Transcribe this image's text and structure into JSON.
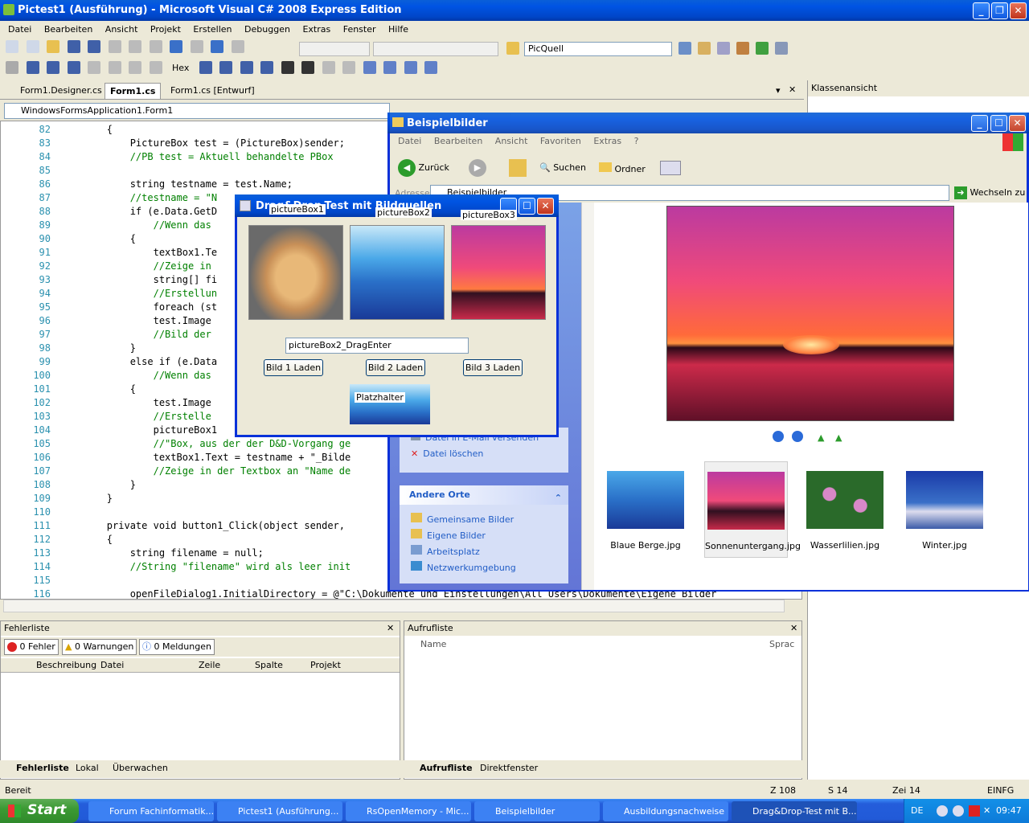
{
  "vs": {
    "title": "Pictest1 (Ausführung) - Microsoft Visual C# 2008 Express Edition",
    "menu": [
      "Datei",
      "Bearbeiten",
      "Ansicht",
      "Projekt",
      "Erstellen",
      "Debuggen",
      "Extras",
      "Fenster",
      "Hilfe"
    ],
    "toolbar_combo": "PicQuell",
    "hex_label": "Hex",
    "tabs": [
      "Form1.Designer.cs",
      "Form1.cs",
      "Form1.cs [Entwurf]"
    ],
    "class_combo": "WindowsFormsApplication1.Form1",
    "classview_title": "Klassenansicht",
    "status": {
      "ready": "Bereit",
      "line": "Z 108",
      "col": "S 14",
      "char": "Zei 14",
      "mode": "EINFG"
    }
  },
  "code": [
    {
      "n": "82",
      "t": "        {"
    },
    {
      "n": "83",
      "t": "            PictureBox test = (PictureBox)sender;"
    },
    {
      "n": "84",
      "t": "            //PB test = Aktuell behandelte PBox"
    },
    {
      "n": "85",
      "t": ""
    },
    {
      "n": "86",
      "t": "            string testname = test.Name;"
    },
    {
      "n": "87",
      "t": "            //testname = \"N"
    },
    {
      "n": "88",
      "t": "            if (e.Data.GetD"
    },
    {
      "n": "89",
      "t": "                //Wenn das"
    },
    {
      "n": "90",
      "t": "            {"
    },
    {
      "n": "91",
      "t": "                textBox1.Te"
    },
    {
      "n": "92",
      "t": "                //Zeige in"
    },
    {
      "n": "93",
      "t": "                string[] fi"
    },
    {
      "n": "94",
      "t": "                //Erstellun"
    },
    {
      "n": "95",
      "t": "                foreach (st"
    },
    {
      "n": "96",
      "t": "                test.Image"
    },
    {
      "n": "97",
      "t": "                //Bild der"
    },
    {
      "n": "98",
      "t": "            }"
    },
    {
      "n": "99",
      "t": "            else if (e.Data"
    },
    {
      "n": "100",
      "t": "                //Wenn das"
    },
    {
      "n": "101",
      "t": "            {"
    },
    {
      "n": "102",
      "t": "                test.Image"
    },
    {
      "n": "103",
      "t": "                //Erstelle"
    },
    {
      "n": "104",
      "t": "                pictureBox1"
    },
    {
      "n": "105",
      "t": "                //\"Box, aus der der D&D-Vorgang ge"
    },
    {
      "n": "106",
      "t": "                textBox1.Text = testname + \"_Bilde"
    },
    {
      "n": "107",
      "t": "                //Zeige in der Textbox an \"Name de"
    },
    {
      "n": "108",
      "t": "            }"
    },
    {
      "n": "109",
      "t": "        }"
    },
    {
      "n": "110",
      "t": ""
    },
    {
      "n": "111",
      "t": "        private void button1_Click(object sender, "
    },
    {
      "n": "112",
      "t": "        {"
    },
    {
      "n": "113",
      "t": "            string filename = null;"
    },
    {
      "n": "114",
      "t": "            //String \"filename\" wird als leer init"
    },
    {
      "n": "115",
      "t": ""
    },
    {
      "n": "116",
      "t": "            openFileDialog1.InitialDirectory = @\"C:\\Dokumente und Einstellungen\\All Users\\Dokumente\\Eigene Bilder"
    }
  ],
  "errors": {
    "title": "Fehlerliste",
    "filters": [
      "0 Fehler",
      "0 Warnungen",
      "0 Meldungen"
    ],
    "columns": [
      "Beschreibung",
      "Datei",
      "Zeile",
      "Spalte",
      "Projekt"
    ],
    "tabs": [
      "Fehlerliste",
      "Lokal",
      "Überwachen"
    ]
  },
  "callstack": {
    "title": "Aufrufliste",
    "columns": [
      "Name",
      "Sprac"
    ],
    "tabs": [
      "Aufrufliste",
      "Direktfenster"
    ]
  },
  "explorer": {
    "title": "Beispielbilder",
    "menu": [
      "Datei",
      "Bearbeiten",
      "Ansicht",
      "Favoriten",
      "Extras",
      "?"
    ],
    "back": "Zurück",
    "search": "Suchen",
    "folders": "Ordner",
    "address_label": "Adresse",
    "address": "Beispielbilder",
    "go": "Wechseln zu",
    "tasks": [
      "Datei in E-Mail versenden",
      "Datei löschen"
    ],
    "other_title": "Andere Orte",
    "other": [
      "Gemeinsame Bilder",
      "Eigene Bilder",
      "Arbeitsplatz",
      "Netzwerkumgebung"
    ],
    "thumbs": [
      "Blaue Berge.jpg",
      "Sonnenuntergang.jpg",
      "Wasserlilien.jpg",
      "Winter.jpg"
    ]
  },
  "dialog": {
    "title": "Drag&Drop-Test mit Bildquellen",
    "pb_labels": [
      "pictureBox1",
      "pictureBox2",
      "pictureBox3"
    ],
    "textbox": "pictureBox2_DragEnter",
    "buttons": [
      "Bild 1 Laden",
      "Bild 2 Laden",
      "Bild 3 Laden"
    ],
    "placeholder": "Platzhalter"
  },
  "taskbar": {
    "start": "Start",
    "items": [
      "Forum Fachinformatik...",
      "Pictest1 (Ausführung...",
      "RsOpenMemory - Mic...",
      "Beispielbilder",
      "Ausbildungsnachweise",
      "Drag&Drop-Test mit B..."
    ],
    "lang": "DE",
    "time": "09:47"
  }
}
